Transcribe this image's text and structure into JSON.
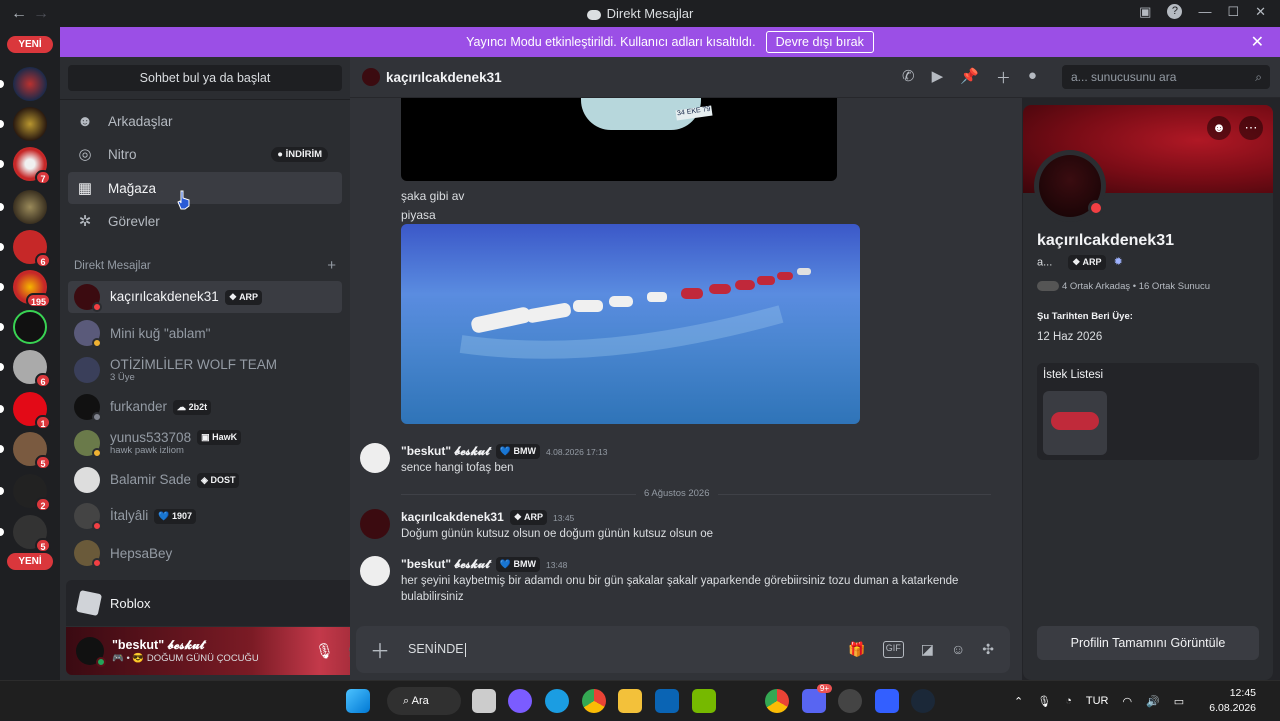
{
  "window": {
    "title": "Direkt Mesajlar",
    "back": "←",
    "forward": "→"
  },
  "guild_badges": {
    "new_top": "YENİ",
    "new_bottom": "YENİ",
    "b1": "7",
    "b2": "6",
    "b3": "195",
    "b4": "6",
    "b5": "6",
    "b6": "1",
    "b7": "5",
    "b8": "2",
    "b9": "5"
  },
  "banner": {
    "text": "Yayıncı Modu etkinleştirildi. Kullanıcı adları kısaltıldı.",
    "button": "Devre dışı bırak",
    "close": "✕"
  },
  "sidebar": {
    "search": "Sohbet bul ya da başlat",
    "nav": [
      {
        "label": "Arkadaşlar",
        "icon": "friends-icon"
      },
      {
        "label": "Nitro",
        "icon": "nitro-icon",
        "tag": "İNDİRİM"
      },
      {
        "label": "Mağaza",
        "icon": "shop-icon"
      },
      {
        "label": "Görevler",
        "icon": "quests-icon"
      }
    ],
    "dm_header": "Direkt Mesajlar",
    "dm_add": "+",
    "dms": [
      {
        "name": "kaçırılcakdenek31",
        "tag": "ARP"
      },
      {
        "name": "Mini kuğ \"ablam\""
      },
      {
        "name": "OTİZİMLİLER WOLF TEAM",
        "sub": "3 Üye"
      },
      {
        "name": "furkander",
        "tag": "2b2t"
      },
      {
        "name": "yunus533708",
        "tag": "HawK",
        "sub": "hawk pawk izliom"
      },
      {
        "name": "Balamir Sade",
        "tag": "DOST"
      },
      {
        "name": "İtalyâli",
        "tag": "1907"
      },
      {
        "name": "HepsaBey"
      }
    ]
  },
  "activity": {
    "name": "Roblox"
  },
  "user": {
    "name": "\"beskut\" 𝓫𝓮𝓼𝓴𝓾𝓽",
    "status": "🎮 • 😎 DOĞUM GÜNÜ ÇOCUĞU"
  },
  "chat": {
    "header_name": "kaçırılcakdenek31",
    "search_placeholder": "a... sunucusunu ara",
    "plate": "34 EKE 79",
    "line1": "şaka gibi av",
    "line2": "piyasa",
    "messages": [
      {
        "author": "\"beskut\" 𝓫𝓮𝓼𝓴𝓾𝓽",
        "tag": "BMW",
        "time": "4.08.2026 17:13",
        "body": "sence hangi tofaş ben"
      },
      {
        "author": "kaçırılcakdenek31",
        "tag": "ARP",
        "time": "13:45",
        "body": "Doğum günün kutsuz olsun oe doğum günün kutsuz olsun oe"
      },
      {
        "author": "\"beskut\" 𝓫𝓮𝓼𝓴𝓾𝓽",
        "tag": "BMW",
        "time": "13:48",
        "body": "her şeyini kaybetmiş bir adamdı onu bir gün şakalar  şakalr yaparkende görebiirsiniz tozu duman a katarkende bulabilirsiniz"
      }
    ],
    "date_divider": "6 Ağustos 2026",
    "composer_text": "SENİNDE"
  },
  "profile": {
    "name": "kaçırılcakdenek31",
    "short": "a...",
    "tag": "ARP",
    "mutual": "4 Ortak Arkadaş • 16 Ortak Sunucu",
    "member_since_label": "Şu Tarihten Beri Üye:",
    "member_since": "12 Haz 2026",
    "wishlist": "İstek Listesi",
    "full_button": "Profilin Tamamını Görüntüle"
  },
  "taskbar": {
    "search": "Ara",
    "lang": "TUR",
    "time": "12:45",
    "date": "6.08.2026",
    "discord_badge": "9+"
  },
  "colors": {
    "banner": "#9b4fe6",
    "accent_red": "#da373c",
    "online": "#23a55a",
    "dnd": "#f23f43"
  }
}
